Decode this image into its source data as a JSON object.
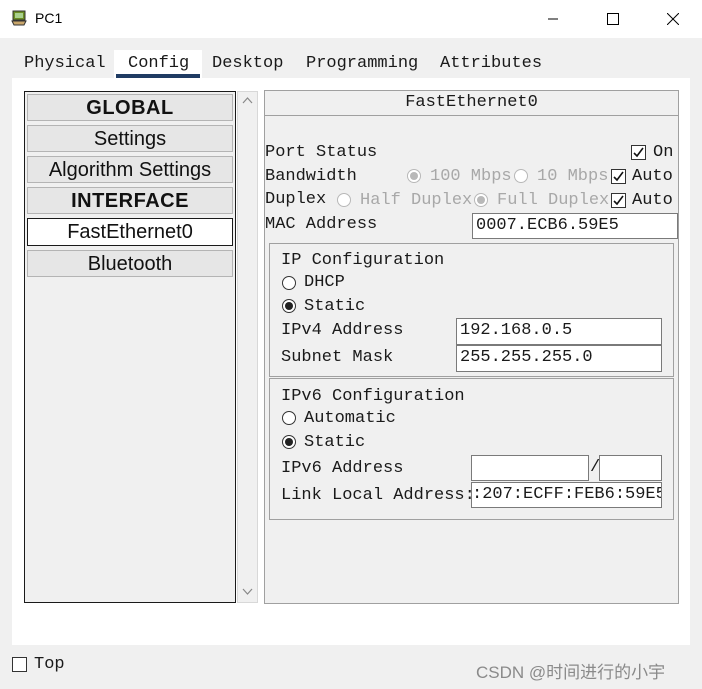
{
  "window": {
    "title": "PC1"
  },
  "tabs": [
    "Physical",
    "Config",
    "Desktop",
    "Programming",
    "Attributes"
  ],
  "sidebar": {
    "items": [
      "GLOBAL",
      "Settings",
      "Algorithm Settings",
      "INTERFACE",
      "FastEthernet0",
      "Bluetooth"
    ]
  },
  "panel": {
    "title": "FastEthernet0",
    "port_status": {
      "label": "Port Status",
      "on_label": "On",
      "on_checked": true
    },
    "bandwidth": {
      "label": "Bandwidth",
      "opt1": "100 Mbps",
      "opt2": "10 Mbps",
      "auto_label": "Auto"
    },
    "duplex": {
      "label": "Duplex",
      "opt1": "Half Duplex",
      "opt2": "Full Duplex",
      "auto_label": "Auto"
    },
    "mac": {
      "label": "MAC Address",
      "value": "0007.ECB6.59E5"
    },
    "ip": {
      "title": "IP Configuration",
      "dhcp": "DHCP",
      "static": "Static",
      "ipv4_label": "IPv4 Address",
      "ipv4_value": "192.168.0.5",
      "mask_label": "Subnet Mask",
      "mask_value": "255.255.255.0"
    },
    "ipv6": {
      "title": "IPv6 Configuration",
      "automatic": "Automatic",
      "static": "Static",
      "addr_label": "IPv6 Address",
      "addr_value": "",
      "prefix_value": "",
      "separator": "/",
      "link_local_label": "Link Local Address:",
      "link_local_value": ":207:ECFF:FEB6:59E5"
    }
  },
  "footer": {
    "top_label": "Top",
    "watermark": "CSDN @时间进行的小宇"
  }
}
